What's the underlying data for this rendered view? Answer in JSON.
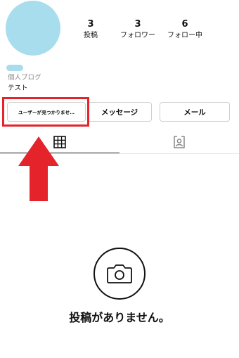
{
  "profile": {
    "category": "個人ブログ",
    "bio": "テスト",
    "avatar_color": "#a7dded"
  },
  "stats": [
    {
      "value": "3",
      "label": "投稿"
    },
    {
      "value": "3",
      "label": "フォロワー"
    },
    {
      "value": "6",
      "label": "フォロー中"
    }
  ],
  "buttons": {
    "not_found": "ユーザーが見つかりませ…",
    "message": "メッセージ",
    "mail": "メール"
  },
  "tabs": {
    "grid_icon": "grid-icon",
    "tagged_icon": "tagged-person-icon",
    "active": "grid"
  },
  "empty_state": {
    "icon": "camera-icon",
    "text": "投稿がありません。"
  },
  "annotation": {
    "highlight_color": "#e5232b",
    "arrow_color": "#e5232b"
  }
}
